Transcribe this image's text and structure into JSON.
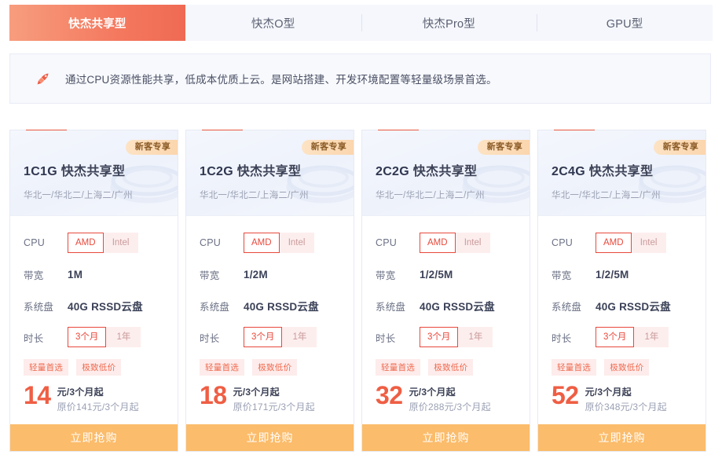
{
  "tabs": [
    {
      "label": "快杰共享型",
      "active": true
    },
    {
      "label": "快杰O型",
      "active": false
    },
    {
      "label": "快杰Pro型",
      "active": false
    },
    {
      "label": "GPU型",
      "active": false
    }
  ],
  "notice": {
    "icon": "rocket-icon",
    "text": "通过CPU资源性能共享，低成本优质上云。是网站搭建、开发环境配置等轻量级场景首选。"
  },
  "colors": {
    "accent_orange": "#ef6a53",
    "price_red": "#ef5e44",
    "buy_button": "#fbbc6b",
    "badge_from": "#fde3c4",
    "badge_to": "#fbd6ae",
    "card_border": "#e7eaf3"
  },
  "labels": {
    "cpu": "CPU",
    "bandwidth": "带宽",
    "system_disk": "系统盘",
    "duration": "时长",
    "buy": "立即抢购",
    "badge": "新客专享"
  },
  "cards": [
    {
      "sku": "1C1G",
      "family": "快杰共享型",
      "badge": "新客专享",
      "regions": "华北一/华北二/上海二/广州",
      "cpu_options": [
        {
          "label": "AMD",
          "selected": true
        },
        {
          "label": "Intel",
          "selected": false
        }
      ],
      "bandwidth": "1M",
      "system_disk": "40G RSSD云盘",
      "duration_options": [
        {
          "label": "3个月",
          "selected": true
        },
        {
          "label": "1年",
          "selected": false
        }
      ],
      "tags": [
        "轻量首选",
        "极致低价"
      ],
      "price": "14",
      "price_unit": "元/3个月起",
      "original_price": "原价141元/3个月起",
      "buy_label": "立即抢购"
    },
    {
      "sku": "1C2G",
      "family": "快杰共享型",
      "badge": "新客专享",
      "regions": "华北一/华北二/上海二/广州",
      "cpu_options": [
        {
          "label": "AMD",
          "selected": true
        },
        {
          "label": "Intel",
          "selected": false
        }
      ],
      "bandwidth": "1/2M",
      "system_disk": "40G RSSD云盘",
      "duration_options": [
        {
          "label": "3个月",
          "selected": true
        },
        {
          "label": "1年",
          "selected": false
        }
      ],
      "tags": [
        "轻量首选",
        "极致低价"
      ],
      "price": "18",
      "price_unit": "元/3个月起",
      "original_price": "原价171元/3个月起",
      "buy_label": "立即抢购"
    },
    {
      "sku": "2C2G",
      "family": "快杰共享型",
      "badge": "新客专享",
      "regions": "华北一/华北二/上海二/广州",
      "cpu_options": [
        {
          "label": "AMD",
          "selected": true
        },
        {
          "label": "Intel",
          "selected": false
        }
      ],
      "bandwidth": "1/2/5M",
      "system_disk": "40G RSSD云盘",
      "duration_options": [
        {
          "label": "3个月",
          "selected": true
        },
        {
          "label": "1年",
          "selected": false
        }
      ],
      "tags": [
        "轻量首选",
        "极致低价"
      ],
      "price": "32",
      "price_unit": "元/3个月起",
      "original_price": "原价288元/3个月起",
      "buy_label": "立即抢购"
    },
    {
      "sku": "2C4G",
      "family": "快杰共享型",
      "badge": "新客专享",
      "regions": "华北一/华北二/上海二/广州",
      "cpu_options": [
        {
          "label": "AMD",
          "selected": true
        },
        {
          "label": "Intel",
          "selected": false
        }
      ],
      "bandwidth": "1/2/5M",
      "system_disk": "40G RSSD云盘",
      "duration_options": [
        {
          "label": "3个月",
          "selected": true
        },
        {
          "label": "1年",
          "selected": false
        }
      ],
      "tags": [
        "轻量首选",
        "极致低价"
      ],
      "price": "52",
      "price_unit": "元/3个月起",
      "original_price": "原价348元/3个月起",
      "buy_label": "立即抢购"
    }
  ]
}
